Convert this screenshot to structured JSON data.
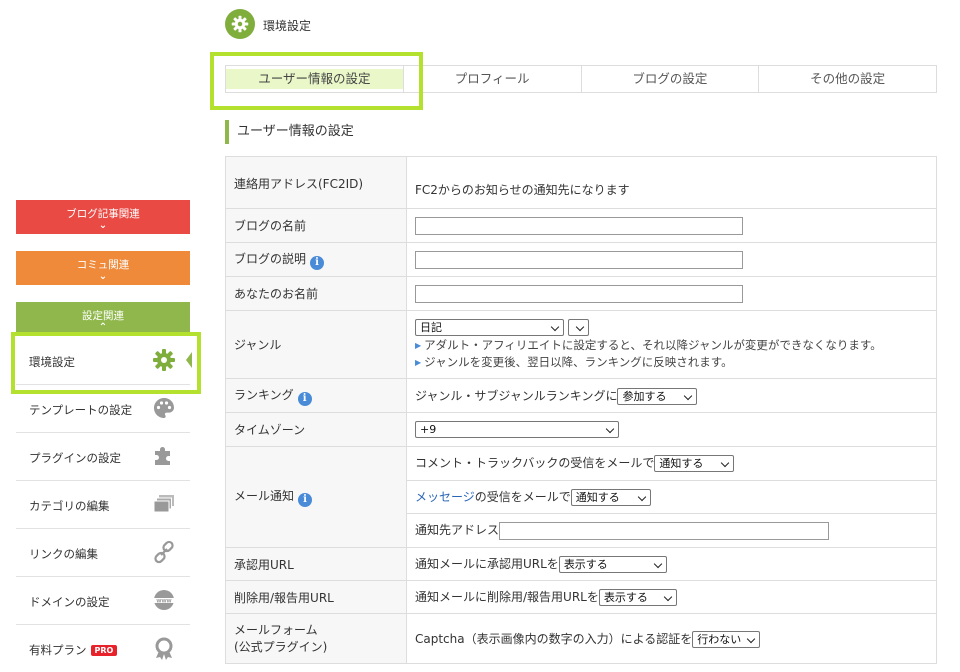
{
  "header": {
    "title": "環境設定"
  },
  "tabs": [
    {
      "label": "ユーザー情報の設定"
    },
    {
      "label": "プロフィール"
    },
    {
      "label": "ブログの設定"
    },
    {
      "label": "その他の設定"
    }
  ],
  "section": {
    "title": "ユーザー情報の設定"
  },
  "sidebar": {
    "categories": [
      {
        "label": "ブログ記事関連",
        "color": "#e94a43"
      },
      {
        "label": "コミュ関連",
        "color": "#ee8a3a"
      },
      {
        "label": "設定関連",
        "color": "#8fb74b"
      }
    ],
    "items": [
      {
        "label": "環境設定",
        "icon": "gear-icon"
      },
      {
        "label": "テンプレートの設定",
        "icon": "palette-icon"
      },
      {
        "label": "プラグインの設定",
        "icon": "puzzle-icon"
      },
      {
        "label": "カテゴリの編集",
        "icon": "stack-icon"
      },
      {
        "label": "リンクの編集",
        "icon": "link-icon"
      },
      {
        "label": "ドメインの設定",
        "icon": "www-globe-icon"
      },
      {
        "label": "有料プラン",
        "icon": "award-icon",
        "badge": "PRO"
      }
    ]
  },
  "form": {
    "contact_address": {
      "label": "連絡用アドレス(FC2ID)",
      "note": "FC2からのお知らせの通知先になります"
    },
    "blog_name": {
      "label": "ブログの名前",
      "value": ""
    },
    "blog_description": {
      "label": "ブログの説明",
      "value": ""
    },
    "your_name": {
      "label": "あなたのお名前",
      "value": ""
    },
    "genre": {
      "label": "ジャンル",
      "selected": "日記",
      "sub_selected": "",
      "notes": [
        "アダルト・アフィリエイトに設定すると、それ以降ジャンルが変更ができなくなります。",
        "ジャンルを変更後、翌日以降、ランキングに反映されます。"
      ]
    },
    "ranking": {
      "label": "ランキング",
      "text": "ジャンル・サブジャンルランキングに",
      "selected": "参加する"
    },
    "timezone": {
      "label": "タイムゾーン",
      "selected": "+9"
    },
    "mail": {
      "label": "メール通知",
      "comment_text": "コメント・トラックバックの受信をメールで",
      "comment_selected": "通知する",
      "message_link": "メッセージ",
      "message_text": "の受信をメールで",
      "message_selected": "通知する",
      "address_label": "通知先アドレス",
      "address_value": ""
    },
    "approval_url": {
      "label": "承認用URL",
      "text": "通知メールに承認用URLを",
      "selected": "表示する"
    },
    "delete_url": {
      "label": "削除用/報告用URL",
      "text": "通知メールに削除用/報告用URLを",
      "selected": "表示する"
    },
    "mailform": {
      "label_line1": "メールフォーム",
      "label_line2": "(公式プラグイン)",
      "text": "Captcha（表示画像内の数字の入力）による認証を",
      "selected": "行わない"
    }
  },
  "colors": {
    "accent_green": "#8fb74b",
    "highlight": "#b4e12e",
    "active_tab_bg": "#eaf7c9",
    "info_blue": "#4a8bd8"
  }
}
